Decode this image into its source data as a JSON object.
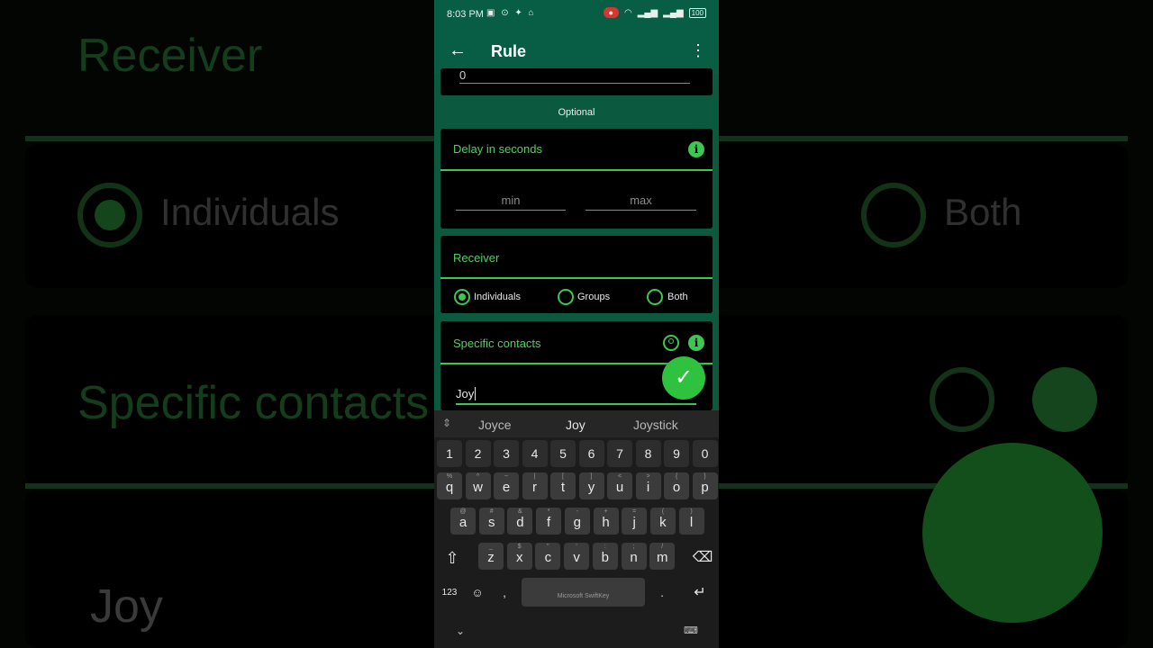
{
  "status_bar": {
    "time": "8:03 PM",
    "battery": "100"
  },
  "app_bar": {
    "title": "Rule"
  },
  "top_field_value": "0",
  "optional_label": "Optional",
  "delay_card": {
    "title": "Delay in seconds",
    "min_placeholder": "min",
    "max_placeholder": "max"
  },
  "receiver_card": {
    "title": "Receiver",
    "options": [
      "Individuals",
      "Groups",
      "Both"
    ],
    "selected": "Individuals"
  },
  "contacts_card": {
    "title": "Specific contacts",
    "input_value": "Joy"
  },
  "keyboard": {
    "suggestions": [
      "Joyce",
      "Joy",
      "Joystick"
    ],
    "number_row": [
      "1",
      "2",
      "3",
      "4",
      "5",
      "6",
      "7",
      "8",
      "9",
      "0"
    ],
    "row1": [
      "q",
      "w",
      "e",
      "r",
      "t",
      "y",
      "u",
      "i",
      "o",
      "p"
    ],
    "row1_hints": [
      "%",
      "^",
      "~",
      "|",
      "[",
      "]",
      "<",
      ">",
      "{",
      "}"
    ],
    "row2": [
      "a",
      "s",
      "d",
      "f",
      "g",
      "h",
      "j",
      "k",
      "l"
    ],
    "row2_hints": [
      "@",
      "#",
      "&",
      "*",
      "-",
      "+",
      "=",
      "(",
      ")"
    ],
    "row3": [
      "z",
      "x",
      "c",
      "v",
      "b",
      "n",
      "m"
    ],
    "row3_hints": [
      "_",
      "$",
      "\"",
      "'",
      ":",
      ";",
      "/"
    ],
    "mode_key": "123",
    "comma_key": ",",
    "period_key": ".",
    "space_label": "Microsoft SwiftKey"
  },
  "colors": {
    "accent": "#3fc552",
    "app_bar": "#075e45",
    "card": "#000000"
  }
}
